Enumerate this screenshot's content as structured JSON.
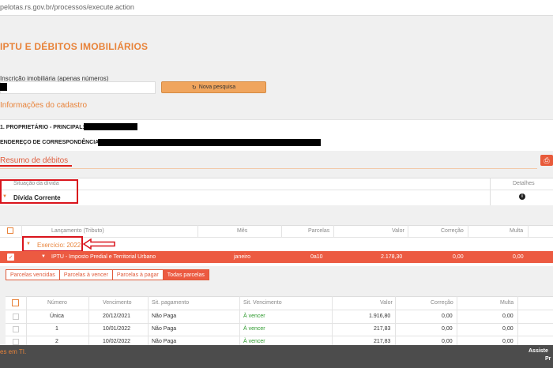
{
  "browser": {
    "url": "pelotas.rs.gov.br/processos/execute.action"
  },
  "header": {
    "title": "IPTU E DÉBITOS IMOBILIÁRIOS"
  },
  "search": {
    "label": "Inscrição imobiliária (apenas números)",
    "value": "",
    "button_label": "Nova pesquisa"
  },
  "cadastro": {
    "title": "Informações do cadastro",
    "owner_label": "1. PROPRIETÁRIO - PRINCIPAL:",
    "address_label": "ENDEREÇO DE CORRESPONDÊNCIA:"
  },
  "debitos": {
    "title": "Resumo de débitos",
    "situacao_header": "Situação da dívida",
    "detalhes_header": "Detalhes",
    "situacao_value": "Dívida Corrente"
  },
  "lancamentos": {
    "headers": [
      "Lançamento (Tributo)",
      "Mês",
      "Parcelas",
      "Valor",
      "Correção",
      "Multa"
    ],
    "exercicio": "Exercício: 2022",
    "row": {
      "tributo": "IPTU - Imposto Predial e Territorial Urbano",
      "mes": "janeiro",
      "parcelas": "0a10",
      "valor": "2.178,30",
      "correcao": "0,00",
      "multa": "0,00"
    }
  },
  "tabs": [
    "Parcelas vencidas",
    "Parcelas à vencer",
    "Parcelas à pagar",
    "Todas parcelas"
  ],
  "active_tab": "Todas parcelas",
  "parcelas": {
    "headers": [
      "Número",
      "Vencimento",
      "Sit. pagamento",
      "Sit. Vencimento",
      "Valor",
      "Correção",
      "Multa"
    ],
    "rows": [
      [
        "Única",
        "20/12/2021",
        "Não Paga",
        "À vencer",
        "1.916,80",
        "0,00",
        "0,00"
      ],
      [
        "1",
        "10/01/2022",
        "Não Paga",
        "À vencer",
        "217,83",
        "0,00",
        "0,00"
      ],
      [
        "2",
        "10/02/2022",
        "Não Paga",
        "À vencer",
        "217,83",
        "0,00",
        "0,00"
      ]
    ]
  },
  "footer": {
    "left": "es em TI.",
    "right1": "Assiste",
    "right2": "Pr"
  },
  "colors": {
    "accent": "#e8833a",
    "danger": "#ec5a41",
    "annotation": "#d9141c",
    "footer": "#4c4c4c"
  }
}
